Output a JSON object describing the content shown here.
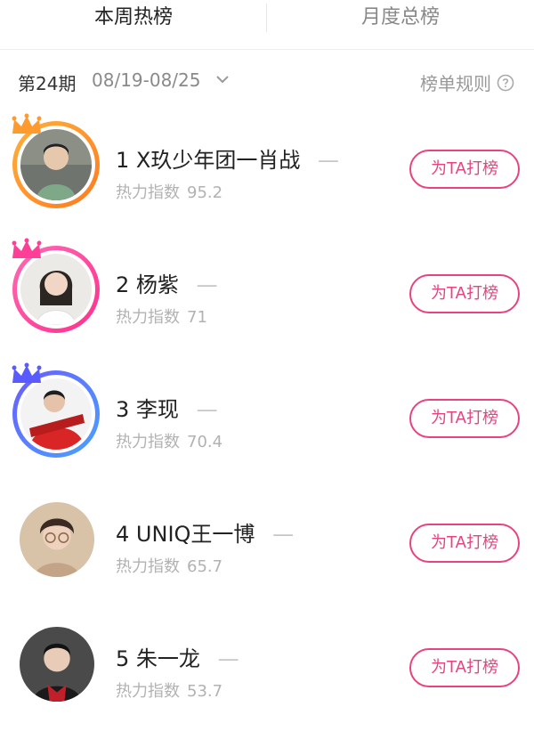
{
  "tabs": [
    {
      "label": "本周热榜",
      "active": true
    },
    {
      "label": "月度总榜",
      "active": false
    }
  ],
  "period": {
    "label": "第24期",
    "dates": "08/19-08/25",
    "rules_label": "榜单规则",
    "dropdown_icon": "chevron-down-icon",
    "help_icon": "question-circle-icon"
  },
  "colors": {
    "accent": "#e8437e",
    "gold": "#ff9a2e",
    "pink": "#ff3e98",
    "blue": "#5a74ff"
  },
  "heat_label": "热力指数",
  "vote_label": "为TA打榜",
  "rank_list": [
    {
      "rank": "1",
      "name": "X玖少年团一肖战",
      "trend": "—",
      "heat": "95.2",
      "crown": "gold"
    },
    {
      "rank": "2",
      "name": "杨紫",
      "trend": "—",
      "heat": "71",
      "crown": "pink"
    },
    {
      "rank": "3",
      "name": "李现",
      "trend": "—",
      "heat": "70.4",
      "crown": "blue"
    },
    {
      "rank": "4",
      "name": "UNIQ王一博",
      "trend": "—",
      "heat": "65.7",
      "crown": ""
    },
    {
      "rank": "5",
      "name": "朱一龙",
      "trend": "—",
      "heat": "53.7",
      "crown": ""
    }
  ]
}
